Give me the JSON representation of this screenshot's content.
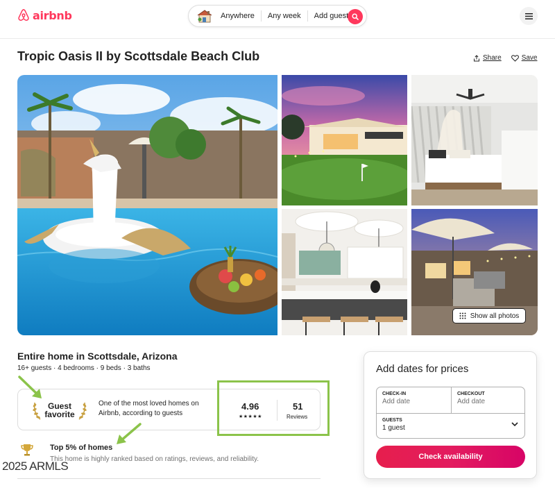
{
  "header": {
    "logo_text": "airbnb",
    "search": {
      "location": "Anywhere",
      "dates": "Any week",
      "guests": "Add guests"
    },
    "icons": [
      "airbnb-logo-icon",
      "home-icon",
      "search-icon",
      "menu-icon"
    ]
  },
  "listing": {
    "title": "Tropic Oasis II by Scottsdale Beach Club",
    "share_label": "Share",
    "save_label": "Save",
    "show_all_photos_label": "Show all photos",
    "subtitle": "Entire home in Scottsdale, Arizona",
    "details": "16+ guests · 4 bedrooms · 9 beds · 3 baths"
  },
  "guest_favorite": {
    "badge_line1": "Guest",
    "badge_line2": "favorite",
    "description": "One of the most loved homes on Airbnb, according to guests",
    "rating": "4.96",
    "stars": "★★★★★",
    "reviews_count": "51",
    "reviews_label": "Reviews"
  },
  "highlight": {
    "title": "Top 5% of homes",
    "description": "This home is highly ranked based on ratings, reviews, and reliability."
  },
  "booking": {
    "title": "Add dates for prices",
    "checkin_label": "CHECK-IN",
    "checkin_value": "Add date",
    "checkout_label": "CHECKOUT",
    "checkout_value": "Add date",
    "guests_label": "GUESTS",
    "guests_value": "1 guest",
    "cta_label": "Check availability"
  },
  "watermark": "2025 ARMLS",
  "colors": {
    "brand": "#ff385c",
    "annotation": "#8bc34a"
  }
}
